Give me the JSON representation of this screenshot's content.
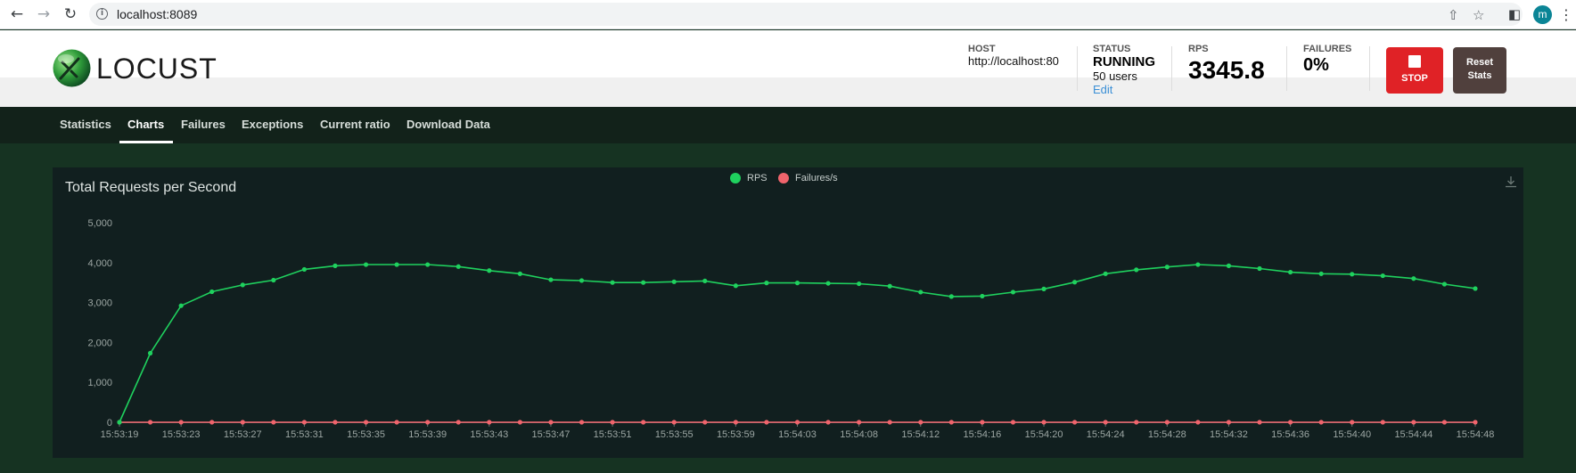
{
  "browser": {
    "url": "localhost:8089",
    "profile_initial": "m",
    "icons": [
      "back-arrow-icon",
      "forward-arrow-icon",
      "reload-icon",
      "info-icon",
      "share-icon",
      "bookmark-star-icon",
      "sidepanel-icon",
      "kebab-menu-icon"
    ]
  },
  "header": {
    "logo_text": "LOCUST",
    "host_label": "HOST",
    "host_value": "http://localhost:80",
    "status_label": "STATUS",
    "status_value": "RUNNING",
    "users_value": "50 users",
    "edit_label": "Edit",
    "rps_label": "RPS",
    "rps_value": "3345.8",
    "failures_label": "FAILURES",
    "failures_value": "0%",
    "stop_label": "STOP",
    "reset_label_line1": "Reset",
    "reset_label_line2": "Stats"
  },
  "tabs": [
    {
      "label": "Statistics",
      "active": false
    },
    {
      "label": "Charts",
      "active": true
    },
    {
      "label": "Failures",
      "active": false
    },
    {
      "label": "Exceptions",
      "active": false
    },
    {
      "label": "Current ratio",
      "active": false
    },
    {
      "label": "Download Data",
      "active": false
    }
  ],
  "colors": {
    "rps": "#1fd15e",
    "failures": "#f0646c",
    "stop": "#e02226",
    "reset": "#50403d"
  },
  "chart_data": {
    "type": "line",
    "title": "Total Requests per Second",
    "ylim": [
      0,
      5000
    ],
    "yticks": [
      "0",
      "1,000",
      "2,000",
      "3,000",
      "4,000",
      "5,000"
    ],
    "y_tick_values": [
      0,
      1000,
      2000,
      3000,
      4000,
      5000
    ],
    "grid": false,
    "legend_position": "top-center",
    "x_tick_labels": [
      "15:53:19",
      "15:53:23",
      "15:53:27",
      "15:53:31",
      "15:53:35",
      "15:53:39",
      "15:53:43",
      "15:53:47",
      "15:53:51",
      "15:53:55",
      "15:53:59",
      "15:54:03",
      "15:54:08",
      "15:54:12",
      "15:54:16",
      "15:54:20",
      "15:54:24",
      "15:54:28",
      "15:54:32",
      "15:54:36",
      "15:54:40",
      "15:54:44",
      "15:54:48"
    ],
    "series": [
      {
        "name": "RPS",
        "color": "#1fd15e",
        "values": [
          0,
          1730,
          2920,
          3270,
          3440,
          3560,
          3830,
          3920,
          3950,
          3950,
          3950,
          3900,
          3800,
          3720,
          3570,
          3550,
          3500,
          3500,
          3520,
          3540,
          3420,
          3490,
          3490,
          3480,
          3470,
          3410,
          3260,
          3150,
          3160,
          3260,
          3340,
          3510,
          3720,
          3820,
          3890,
          3950,
          3920,
          3850,
          3760,
          3720,
          3710,
          3670,
          3600,
          3460,
          3350
        ]
      },
      {
        "name": "Failures/s",
        "color": "#f0646c",
        "values": [
          0,
          0,
          0,
          0,
          0,
          0,
          0,
          0,
          0,
          0,
          0,
          0,
          0,
          0,
          0,
          0,
          0,
          0,
          0,
          0,
          0,
          0,
          0,
          0,
          0,
          0,
          0,
          0,
          0,
          0,
          0,
          0,
          0,
          0,
          0,
          0,
          0,
          0,
          0,
          0,
          0,
          0,
          0,
          0,
          0
        ]
      }
    ]
  }
}
